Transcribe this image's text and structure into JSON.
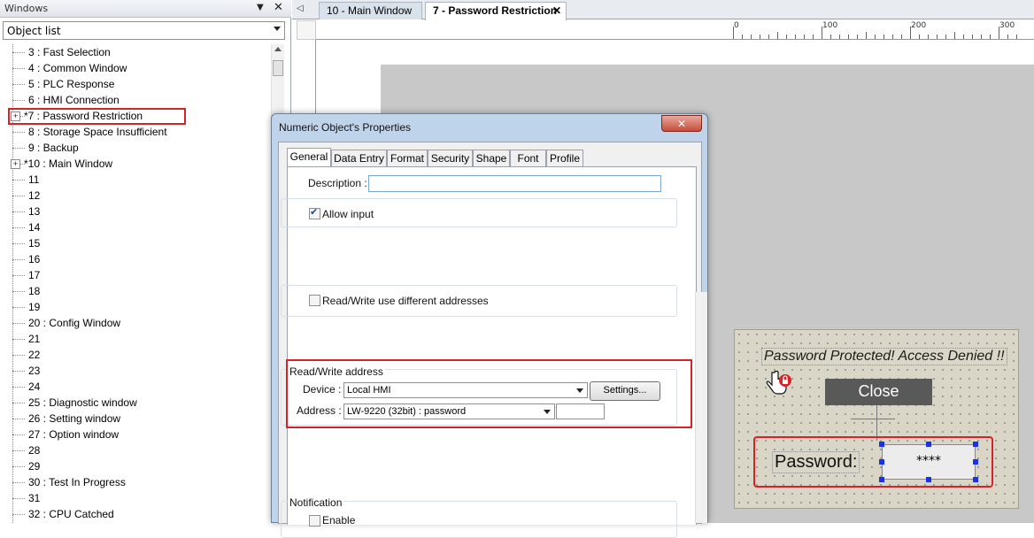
{
  "left_panel": {
    "title": "Windows",
    "pin_glyph": "▼",
    "close_glyph": "✕",
    "dropdown_value": "Object list",
    "tree_items": [
      {
        "label": "3 : Fast Selection",
        "expandable": false
      },
      {
        "label": "4 : Common Window",
        "expandable": false
      },
      {
        "label": "5 : PLC Response",
        "expandable": false
      },
      {
        "label": "6 : HMI Connection",
        "expandable": false
      },
      {
        "label": "*7 : Password Restriction",
        "expandable": true
      },
      {
        "label": "8 : Storage Space Insufficient",
        "expandable": false
      },
      {
        "label": "9 : Backup",
        "expandable": false
      },
      {
        "label": "*10 : Main Window",
        "expandable": true
      },
      {
        "label": "11",
        "expandable": false
      },
      {
        "label": "12",
        "expandable": false
      },
      {
        "label": "13",
        "expandable": false
      },
      {
        "label": "14",
        "expandable": false
      },
      {
        "label": "15",
        "expandable": false
      },
      {
        "label": "16",
        "expandable": false
      },
      {
        "label": "17",
        "expandable": false
      },
      {
        "label": "18",
        "expandable": false
      },
      {
        "label": "19",
        "expandable": false
      },
      {
        "label": "20 : Config Window",
        "expandable": false
      },
      {
        "label": "21",
        "expandable": false
      },
      {
        "label": "22",
        "expandable": false
      },
      {
        "label": "23",
        "expandable": false
      },
      {
        "label": "24",
        "expandable": false
      },
      {
        "label": "25 : Diagnostic window",
        "expandable": false
      },
      {
        "label": "26 : Setting window",
        "expandable": false
      },
      {
        "label": "27 : Option window",
        "expandable": false
      },
      {
        "label": "28",
        "expandable": false
      },
      {
        "label": "29",
        "expandable": false
      },
      {
        "label": "30 : Test In Progress",
        "expandable": false
      },
      {
        "label": "31",
        "expandable": false
      },
      {
        "label": "32 : CPU Catched",
        "expandable": false
      }
    ]
  },
  "tabs": {
    "nav_glyph": "◁",
    "items": [
      {
        "label": "10 - Main Window",
        "active": false
      },
      {
        "label": "7 - Password Restriction",
        "active": true
      }
    ],
    "close_glyph": "✕"
  },
  "ruler": {
    "labels": [
      "0",
      "100",
      "200",
      "300"
    ]
  },
  "dialog": {
    "title": "Numeric Object's Properties",
    "close_glyph": "✕",
    "tabs": [
      "General",
      "Data Entry",
      "Format",
      "Security",
      "Shape",
      "Font",
      "Profile"
    ],
    "active_tab": "General",
    "description_label": "Description :",
    "description_value": "",
    "allow_input_label": "Allow input",
    "allow_input_checked": true,
    "rw_different_label": "Read/Write use different addresses",
    "rw_different_checked": false,
    "rw_group_title": "Read/Write address",
    "device_label": "Device :",
    "device_value": "Local HMI",
    "settings_button": "Settings...",
    "address_label": "Address :",
    "address_value": "LW-9220 (32bit) : password",
    "notification_title": "Notification",
    "enable_label": "Enable",
    "enable_checked": false
  },
  "window_preview": {
    "denied_text": "Password Protected! Access Denied !!",
    "close_button": "Close",
    "password_label": "Password:",
    "password_value": "****"
  },
  "colors": {
    "highlight": "#d6232a",
    "canvas_gray": "#c8c8c8",
    "window_bg": "#d9d6c8",
    "close_btn_bg": "#595959",
    "handle_blue": "#1a32e6"
  }
}
